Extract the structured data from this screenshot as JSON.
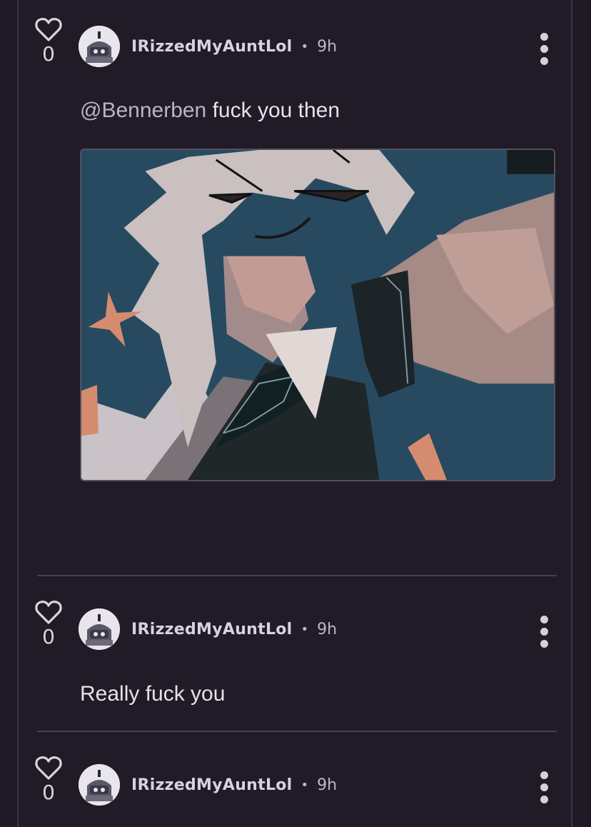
{
  "comments": [
    {
      "votes": "0",
      "username": "IRizzedMyAuntLol",
      "separator": "•",
      "time": "9h",
      "mention": "@Bennerben",
      "text": " fuck you then",
      "has_media": true
    },
    {
      "votes": "0",
      "username": "IRizzedMyAuntLol",
      "separator": "•",
      "time": "9h",
      "text": "Really fuck you"
    },
    {
      "votes": "0",
      "username": "IRizzedMyAuntLol",
      "separator": "•",
      "time": "9h"
    }
  ],
  "icons": {
    "vote": "heart-outline-icon",
    "menu": "more-vertical-icon"
  },
  "colors": {
    "background": "#211b28",
    "text": "#e6e2ec",
    "muted": "#bcb6c6",
    "divider": "#45404d"
  }
}
